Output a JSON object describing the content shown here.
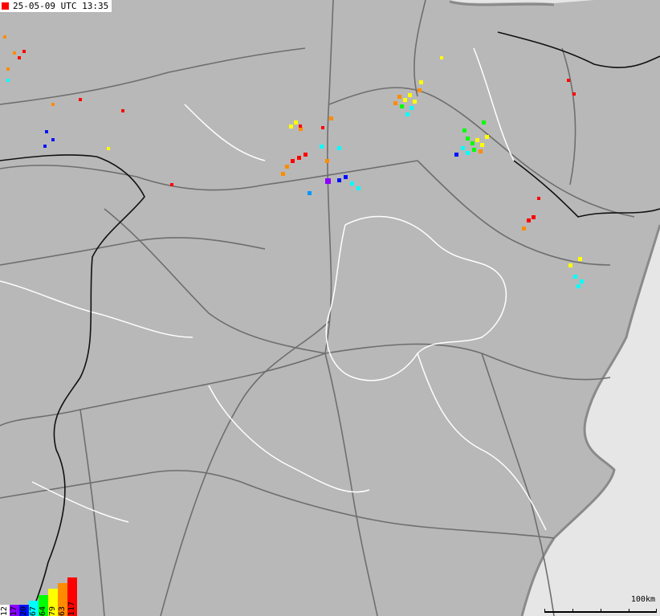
{
  "header": {
    "timestamp": "25-05-09 UTC 13:35",
    "marker_color": "#ff0000"
  },
  "legend": [
    {
      "label": "12",
      "color": "#ffffff",
      "level": 0.05
    },
    {
      "label": "17",
      "color": "#8a00ff",
      "level": 0.1
    },
    {
      "label": "20",
      "color": "#0010ff",
      "level": 0.25
    },
    {
      "label": "67",
      "color": "#00ffff",
      "level": 0.4
    },
    {
      "label": "64",
      "color": "#00ff00",
      "level": 0.55
    },
    {
      "label": "79",
      "color": "#ffff00",
      "level": 0.7
    },
    {
      "label": "63",
      "color": "#ff8c00",
      "level": 0.85
    },
    {
      "label": "117",
      "color": "#ff0000",
      "level": 1.0
    }
  ],
  "scale": {
    "label": "100km"
  },
  "colors": {
    "land": "#b8b8b8",
    "sea": "#e6e6e6",
    "roads": "#6e6e6e",
    "borders": "#000000",
    "regions": "#ffffff"
  }
}
